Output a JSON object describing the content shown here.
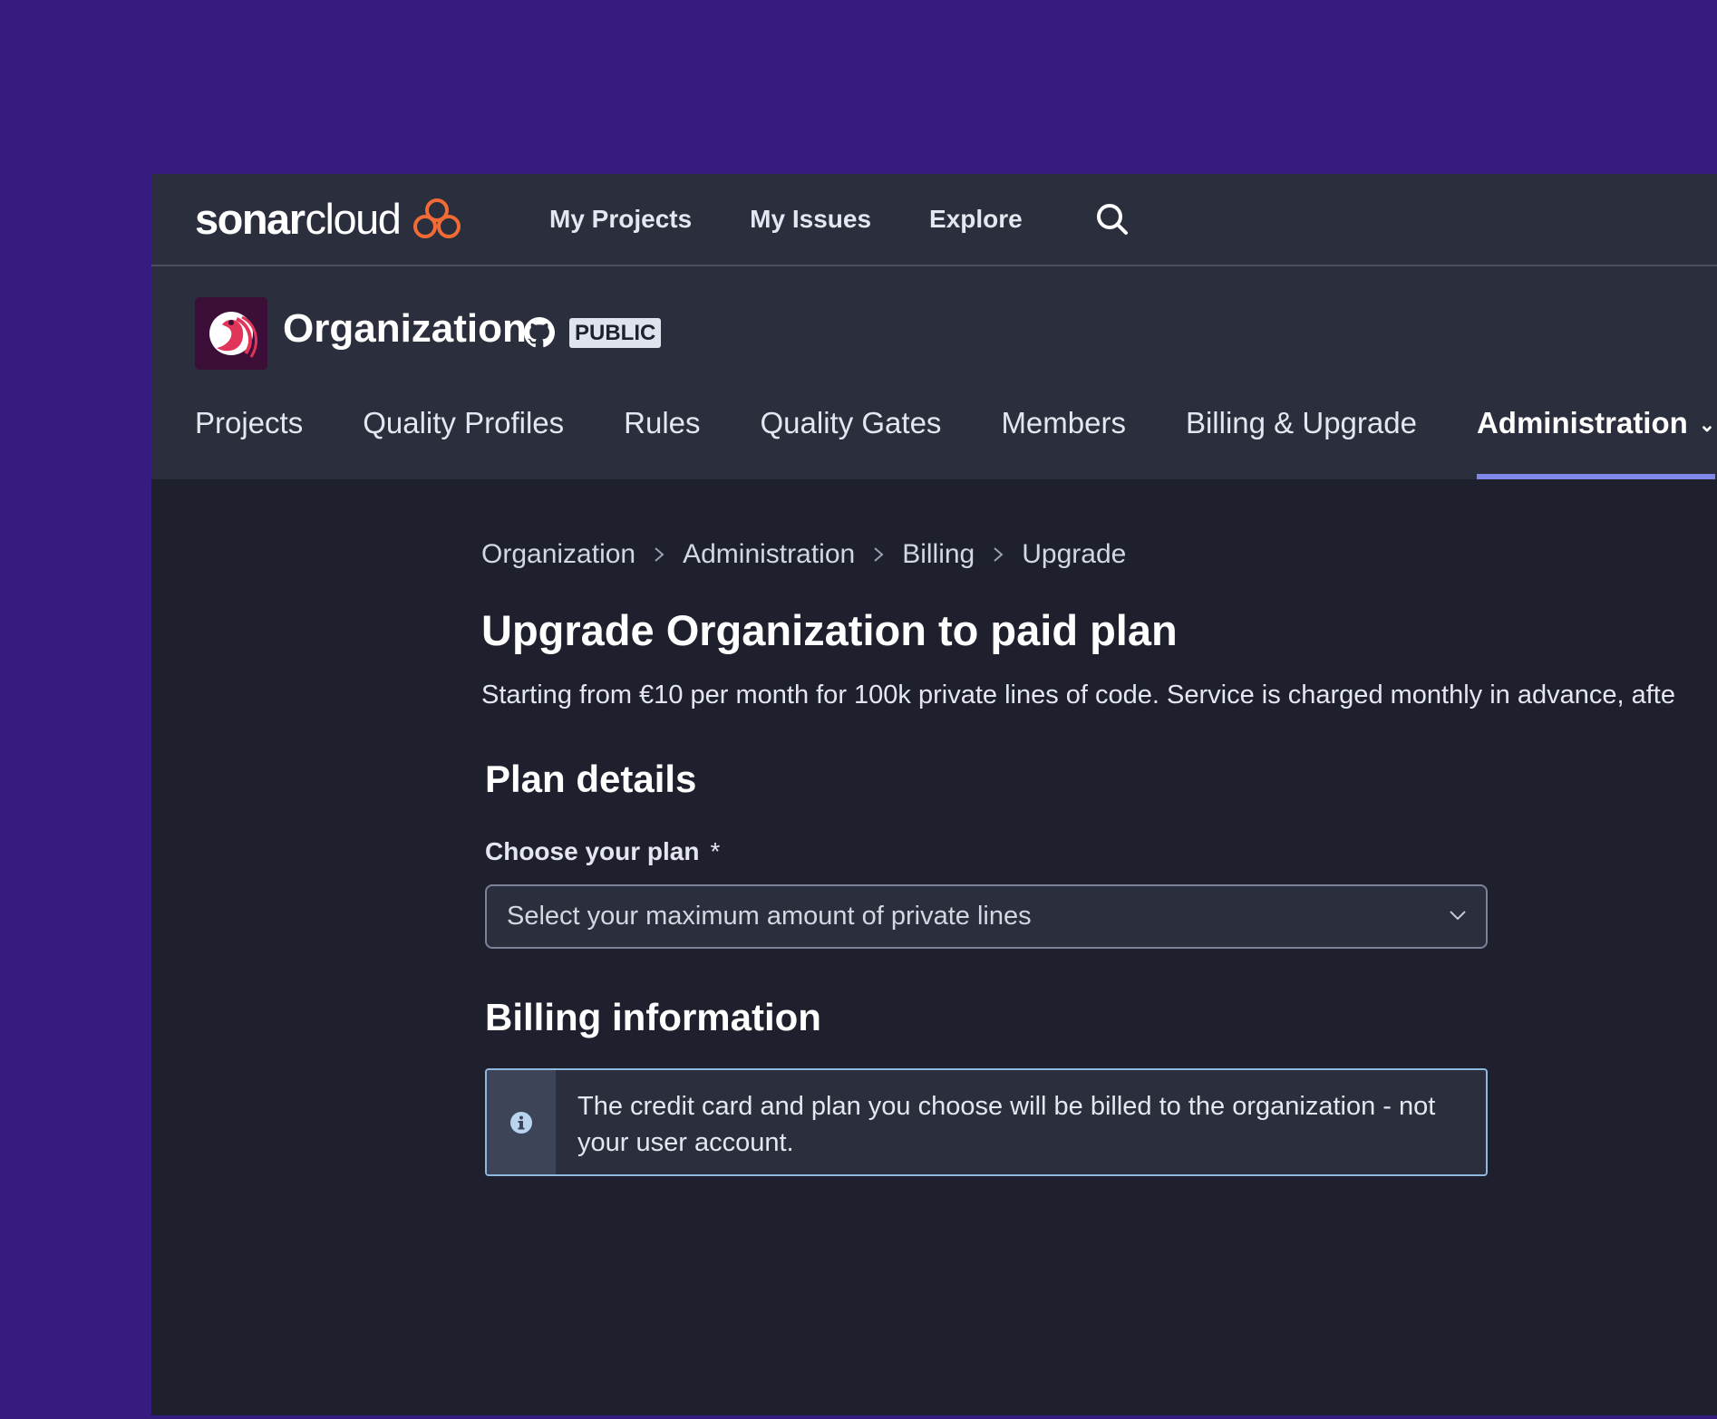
{
  "topbar": {
    "logo_bold": "sonar",
    "logo_regular": "cloud",
    "nav": [
      "My Projects",
      "My Issues",
      "Explore"
    ],
    "search_icon": "search-icon"
  },
  "org": {
    "name": "Organization",
    "badge": "PUBLIC",
    "tabs": [
      "Projects",
      "Quality Profiles",
      "Rules",
      "Quality Gates",
      "Members",
      "Billing & Upgrade",
      "Administration"
    ],
    "active_tab": "Administration"
  },
  "breadcrumb": [
    "Organization",
    "Administration",
    "Billing",
    "Upgrade"
  ],
  "page": {
    "title": "Upgrade Organization to paid plan",
    "description": "Starting from €10 per month for 100k private lines of code. Service is charged monthly in advance, afte"
  },
  "plan": {
    "section_title": "Plan details",
    "label": "Choose your plan",
    "required_mark": "*",
    "select_placeholder": "Select your maximum amount of private lines"
  },
  "billing": {
    "section_title": "Billing information",
    "info_text": "The credit card and plan you choose will be billed to the organization - not your user account."
  },
  "colors": {
    "background": "#361c80",
    "app_bg": "#1e212d",
    "header_bg": "#2a2e3d",
    "accent": "#7f87e8",
    "logo_orange": "#f26b35"
  }
}
